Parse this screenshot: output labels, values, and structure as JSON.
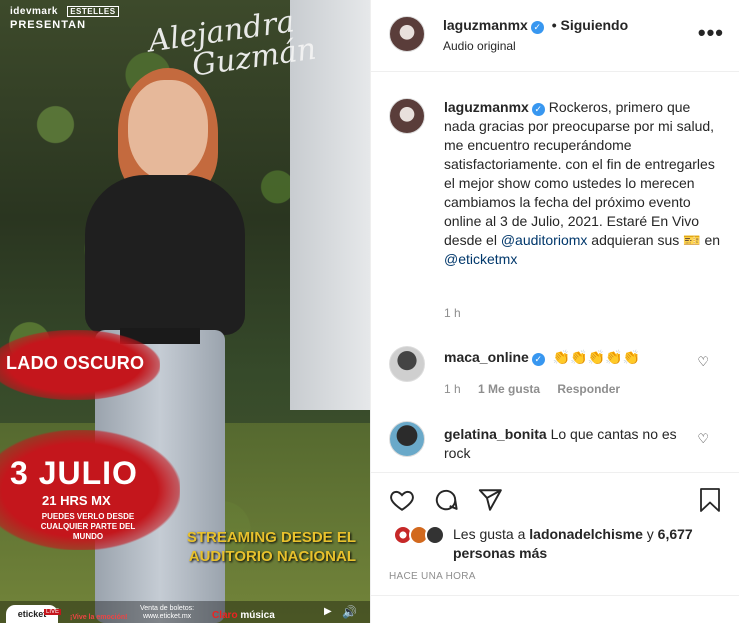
{
  "media": {
    "brand_top": "idevmark",
    "brand_top_2": "ESTELLES",
    "presentan": "PRESENTAN",
    "signature_line1": "Alejandra",
    "signature_line2": "Guzmán",
    "lado_oscuro": "LADO OSCURO",
    "date": "3 JULIO",
    "hour": "21 HRS MX",
    "where": "PUEDES VERLO DESDE CUALQUIER PARTE DEL MUNDO",
    "streaming_line1": "STREAMING DESDE EL",
    "streaming_line2": "AUDITORIO NACIONAL",
    "ticket_logo": "eticket",
    "live": "LIVE",
    "fine1": "¡Vive la emoción!",
    "sale_line1": "Venta de boletos:",
    "sale_line2": "www.eticket.mx",
    "claro": "Claro",
    "musica": "música"
  },
  "header": {
    "username": "laguzmanmx",
    "follow_status": "• Siguiendo",
    "audio": "Audio original",
    "more": "•••"
  },
  "caption": {
    "username": "laguzmanmx",
    "text": "Rockeros, primero que nada gracias por preocuparse por mi salud, me encuentro recuperándome satisfactoriamente. con el fin de entregarles el mejor show como ustedes lo merecen cambiamos la fecha del próximo evento online al 3 de Julio, 2021. Estaré En Vivo desde el",
    "mention1": "@auditoriomx",
    "text2": "adquieran sus",
    "ticket_emoji": "🎫",
    "text3": "en",
    "mention2": "@eticketmx",
    "time": "1 h"
  },
  "comments": [
    {
      "username": "maca_online",
      "text": "👏👏👏👏👏",
      "time": "1 h",
      "likes": "1 Me gusta",
      "reply": "Responder"
    },
    {
      "username": "gelatina_bonita",
      "text": "Lo que cantas no es rock"
    }
  ],
  "likes": {
    "prefix": "Les gusta a",
    "user": "ladonadelchisme",
    "and": "y",
    "count": "6,677 personas más"
  },
  "timestamp": "HACE UNA HORA",
  "colors": {
    "link": "#00376b",
    "verified": "#3897f0",
    "muted": "#8e8e8e"
  }
}
